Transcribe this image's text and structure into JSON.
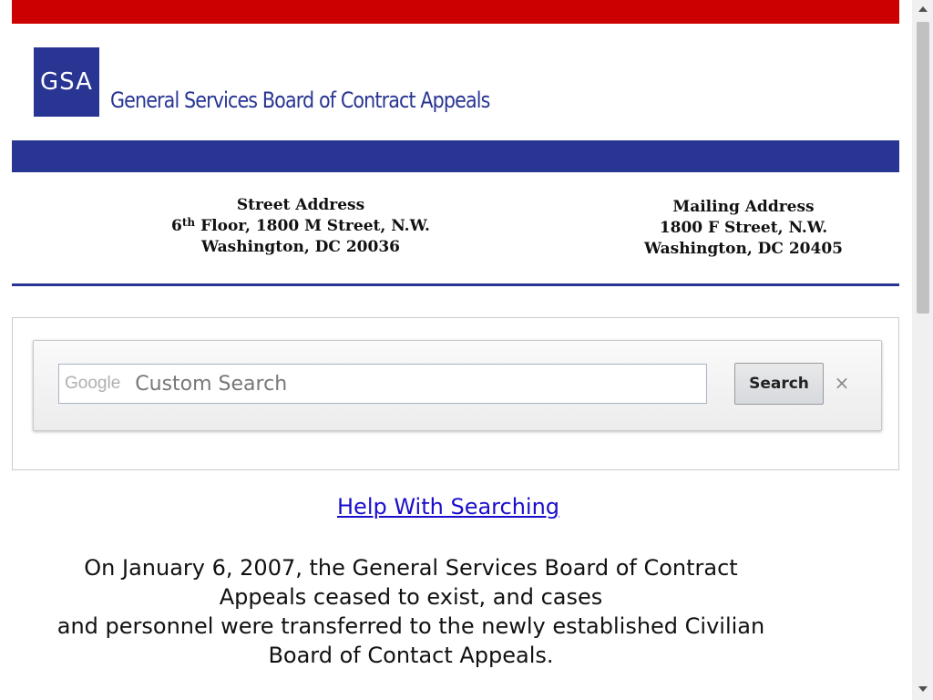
{
  "header": {
    "logo_text": "GSA",
    "agency_name": "General Services Board of Contract Appeals",
    "colors": {
      "top_bar": "#cc0000",
      "brand_blue": "#283593"
    }
  },
  "addresses": {
    "street": {
      "heading": "Street Address",
      "floor_num": "6",
      "floor_sup": "th",
      "floor_rest": " Floor, 1800 M Street, N.W.",
      "city": "Washington, DC 20036"
    },
    "mailing": {
      "heading": "Mailing Address",
      "line1": "1800 F Street, N.W.",
      "city": "Washington, DC 20405"
    }
  },
  "search": {
    "google_mark": "Google",
    "placeholder": "Custom Search",
    "button_label": "Search",
    "clear_icon": "close-icon",
    "clear_label": "×"
  },
  "help_link": "Help With Searching",
  "notice": {
    "lines": [
      "On January 6, 2007, the General Services Board of Contract",
      "Appeals ceased to exist, and cases",
      "and personnel were transferred to the newly established Civilian",
      "Board of Contact Appeals."
    ]
  }
}
